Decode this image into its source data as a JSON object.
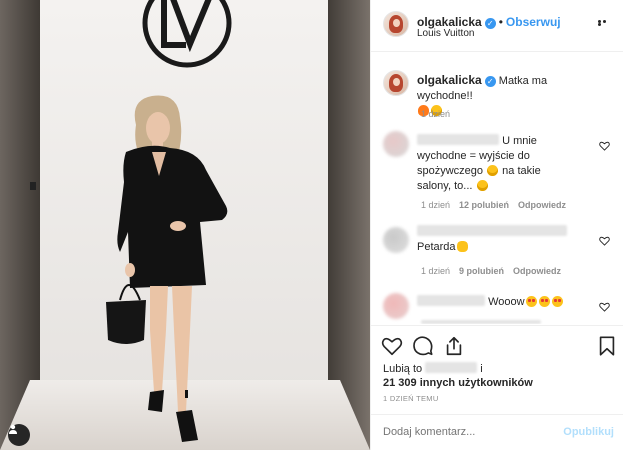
{
  "post": {
    "author": "olgakalicka",
    "follow_label": "Obserwuj",
    "dot": "•",
    "location": "Louis Vuitton",
    "caption_text": "Matka ma wychodne!!",
    "caption_time": "1 dzień",
    "verified_mark": "✓"
  },
  "comments": [
    {
      "text": "U mnie wychodne = wyjście do spożywczego",
      "text_tail": "na takie salony, to...",
      "time": "1 dzień",
      "likes": "12 polubień",
      "reply": "Odpowiedz"
    },
    {
      "text": "Petarda",
      "time": "1 dzień",
      "likes": "9 polubień",
      "reply": "Odpowiedz"
    },
    {
      "text": "Wooow"
    }
  ],
  "likes": {
    "prefix": "Lubią to",
    "suffix": "i",
    "others": "21 309 innych użytkowników"
  },
  "time_ago": "1 DZIEŃ TEMU",
  "comment_box": {
    "placeholder": "Dodaj komentarz...",
    "publish": "Opublikuj"
  },
  "colors": {
    "link": "#3897f0",
    "publish_disabled": "#b2dffc",
    "muted": "#8e8e8e"
  },
  "icons": [
    "heart-icon",
    "comment-icon",
    "share-icon",
    "bookmark-icon",
    "more-icon",
    "user-tag-icon",
    "verified-icon"
  ]
}
